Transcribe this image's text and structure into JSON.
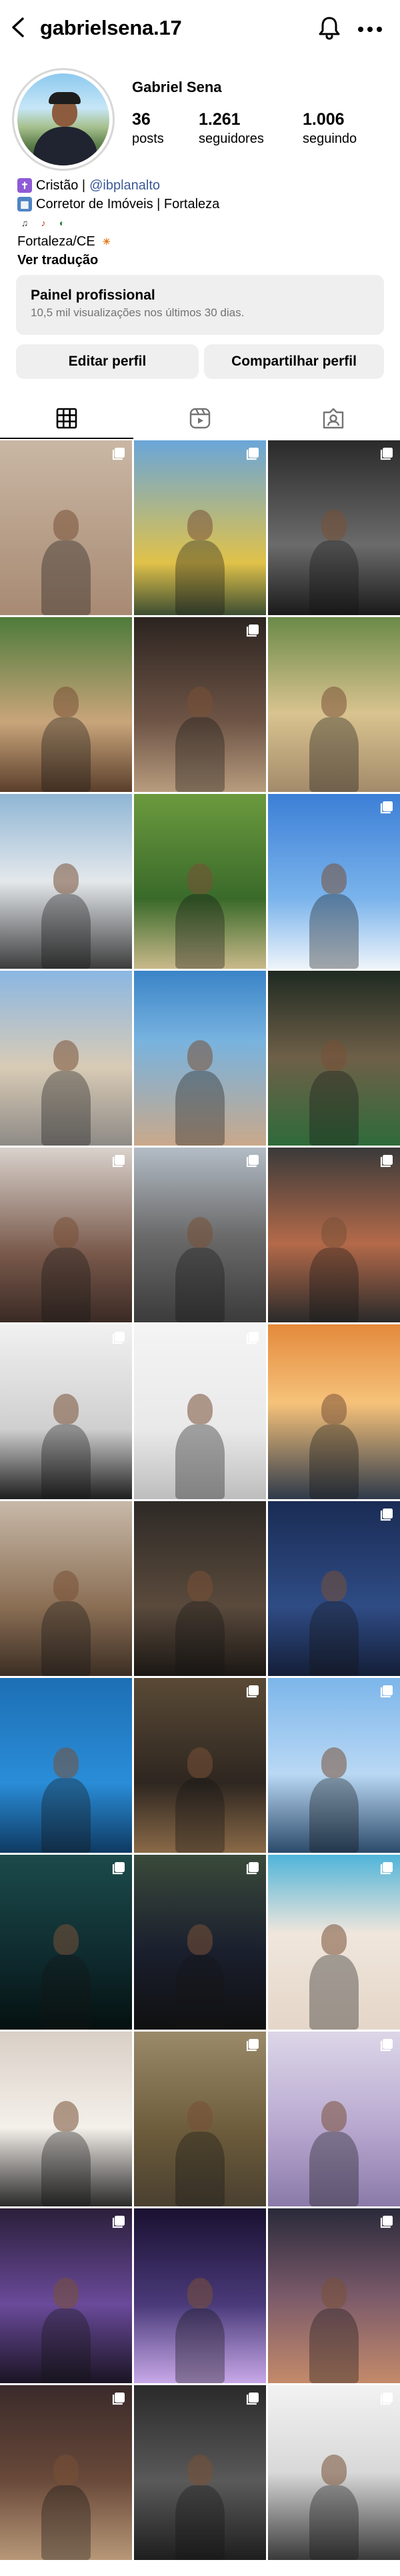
{
  "header": {
    "username": "gabrielsena.17",
    "back_icon": "chevron-left-icon",
    "notifications_icon": "bell-icon",
    "more_icon": "more-horizontal-icon"
  },
  "profile": {
    "full_name": "Gabriel Sena",
    "stats": {
      "posts_count": "36",
      "posts_label": "posts",
      "followers_count": "1.261",
      "followers_label": "seguidores",
      "following_count": "1.006",
      "following_label": "seguindo"
    }
  },
  "bio": {
    "line1_text": "Cristão | ",
    "line1_link": "@ibplanalto",
    "line2_text": "Corretor de Imóveis | Fortaleza",
    "line4_text": "Fortaleza/CE",
    "translate": "Ver tradução"
  },
  "panel": {
    "title": "Painel profissional",
    "subtitle": "10,5 mil visualizações nos últimos 30 dias."
  },
  "buttons": {
    "edit": "Editar perfil",
    "share": "Compartilhar perfil"
  },
  "tabs": [
    "posts-grid-icon",
    "reels-icon",
    "tagged-icon"
  ],
  "grid_posts": [
    {
      "bg": "linear-gradient(180deg,#c9b7a4,#a88a73)",
      "multi": true
    },
    {
      "bg": "linear-gradient(180deg,#6aa6d9,#e0c24a 70%,#3d4e32)",
      "multi": true
    },
    {
      "bg": "linear-gradient(180deg,#2a2a2a,#6b6b6b 60%,#1a1a1a)",
      "multi": true
    },
    {
      "bg": "linear-gradient(180deg,#4e7b3a,#c9a57b 60%,#5a3f2b)",
      "multi": false
    },
    {
      "bg": "linear-gradient(180deg,#2c2420,#6e5546 60%,#b89c7e)",
      "multi": true
    },
    {
      "bg": "linear-gradient(180deg,#6a8a48,#d9c38f 55%,#a38a6a)",
      "multi": false
    },
    {
      "bg": "linear-gradient(180deg,#8fb6d4,#e4e8ec 50%,#3d3d3d)",
      "multi": false
    },
    {
      "bg": "linear-gradient(180deg,#6b9a3e,#3a6a2a 60%,#c9b98a)",
      "multi": false
    },
    {
      "bg": "linear-gradient(180deg,#3c7fd6,#7bb4ec 60%,#eef4fa)",
      "multi": true
    },
    {
      "bg": "linear-gradient(180deg,#8ab7e3,#d8cbb6 55%,#8e8a86)",
      "multi": false
    },
    {
      "bg": "linear-gradient(180deg,#3a84c8,#78b3df 40%,#c9a88a)",
      "multi": false
    },
    {
      "bg": "linear-gradient(180deg,#1f2a22,#6e6048 50%,#2f6b3a)",
      "multi": false
    },
    {
      "bg": "linear-gradient(180deg,#d9d2cc,#7a5a4c 60%,#3a2a24)",
      "multi": true
    },
    {
      "bg": "linear-gradient(180deg,#b3bcc6,#6b6b6b 50%,#3b3b3b)",
      "multi": true
    },
    {
      "bg": "linear-gradient(180deg,#3a3a3a,#b46a4a 55%,#2a2a2a)",
      "multi": true
    },
    {
      "bg": "linear-gradient(180deg,#f1f1f1,#cfcfcf 60%,#1e1e1e)",
      "multi": true
    },
    {
      "bg": "linear-gradient(180deg,#f4f4f4,#e9e9e9 60%,#bdbdbd)",
      "multi": true
    },
    {
      "bg": "linear-gradient(180deg,#e48a3c,#f6c27a 45%,#2f3a4a)",
      "multi": false
    },
    {
      "bg": "linear-gradient(180deg,#c7b9a8,#8b6f55 60%,#3c2e24)",
      "multi": false
    },
    {
      "bg": "linear-gradient(180deg,#2e2a26,#5a4a3c 60%,#1b1714)",
      "multi": false
    },
    {
      "bg": "linear-gradient(180deg,#1a2c55,#2f4c85 60%,#141e38)",
      "multi": true
    },
    {
      "bg": "linear-gradient(180deg,#1d6fb4,#2a8dd8 60%,#0e3a62)",
      "multi": false
    },
    {
      "bg": "linear-gradient(180deg,#5a4a36,#2e2620 60%,#8a6a48)",
      "multi": true
    },
    {
      "bg": "linear-gradient(180deg,#7cb6ea,#b9d8f4 55%,#2c4a6a)",
      "multi": true
    },
    {
      "bg": "linear-gradient(180deg,#1c4a4a,#0e2a2e 60%,#05100f)",
      "multi": true
    },
    {
      "bg": "linear-gradient(180deg,#3a4a3a,#1a1f2e 55%,#101010)",
      "multi": true
    },
    {
      "bg": "linear-gradient(180deg,#4fb4d9,#f0e6dc 45%,#e4d6c8)",
      "multi": true
    },
    {
      "bg": "linear-gradient(180deg,#d9cfc6,#f4f0ea 55%,#2a2a2a)",
      "multi": false
    },
    {
      "bg": "linear-gradient(180deg,#9a8a6a,#6a5a3a 60%,#4a4030)",
      "multi": true
    },
    {
      "bg": "linear-gradient(180deg,#dcd6e8,#b8a8d0 55%,#8a7aa8)",
      "multi": true
    },
    {
      "bg": "linear-gradient(180deg,#2a1f3a,#6a4a9a 55%,#1a1424)",
      "multi": true
    },
    {
      "bg": "linear-gradient(180deg,#1a1030,#4a3a7a 55%,#c8a8e8)",
      "multi": false
    },
    {
      "bg": "linear-gradient(180deg,#2a2a3a,#7a5a6a 50%,#c48a6a)",
      "multi": true
    },
    {
      "bg": "linear-gradient(180deg,#3a2a2a,#6a4a3a 55%,#b89878)",
      "multi": true
    },
    {
      "bg": "linear-gradient(180deg,#2a2a2a,#5a5a5a 55%,#1e1e1e)",
      "multi": true
    },
    {
      "bg": "linear-gradient(180deg,#f2f2f2,#d8d8d8 50%,#3a3a3a)",
      "multi": true
    }
  ]
}
